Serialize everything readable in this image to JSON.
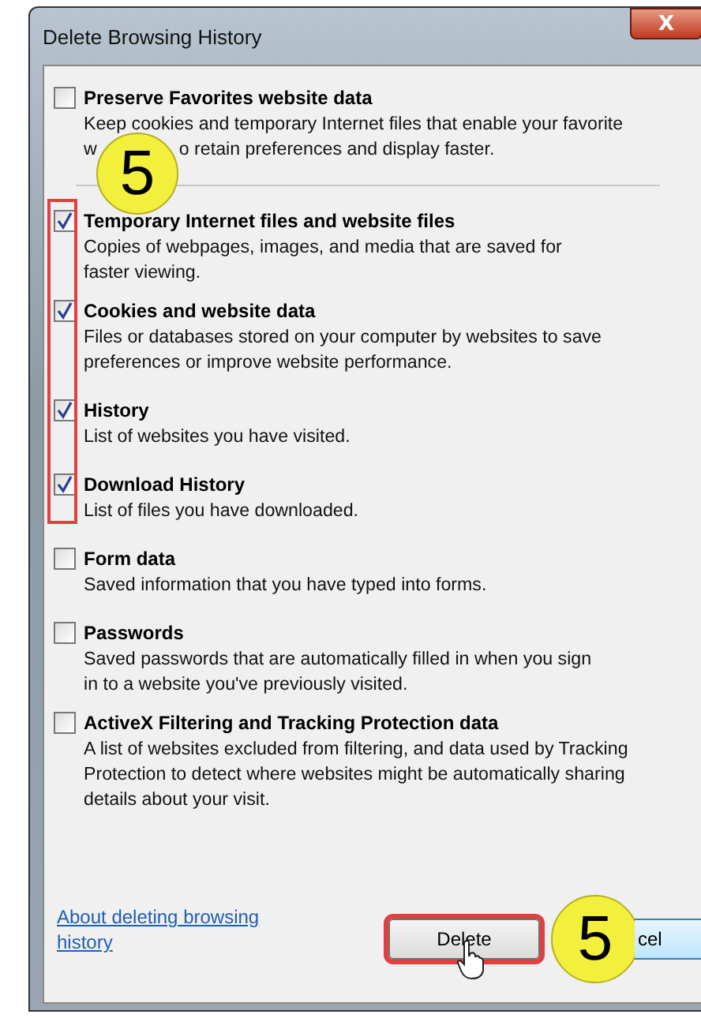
{
  "window": {
    "title": "Delete Browsing History",
    "close": "X"
  },
  "preserve": {
    "label": "Preserve Favorites website data",
    "description_line": "Keep cookies and temporary Internet files that enable your favorite",
    "description_fragments": [
      "w",
      "o retain preferences and display faster."
    ],
    "checked": false
  },
  "options": [
    {
      "label": "Temporary Internet files and website files",
      "description": "Copies of webpages, images, and media that are saved for\nfaster viewing.",
      "checked": true
    },
    {
      "label": "Cookies and website data",
      "description": "Files or databases stored on your computer by websites to save\npreferences or improve website performance.",
      "checked": true
    },
    {
      "label": "History",
      "description": "List of websites you have visited.",
      "checked": true
    },
    {
      "label": "Download History",
      "description": "List of files you have downloaded.",
      "checked": true
    },
    {
      "label": "Form data",
      "description": "Saved information that you have typed into forms.",
      "checked": false
    },
    {
      "label": "Passwords",
      "description": "Saved passwords that are automatically filled in when you sign\nin to a website you've previously visited.",
      "checked": false
    },
    {
      "label": "ActiveX Filtering and Tracking Protection data",
      "description": "A list of websites excluded from filtering, and data used by Tracking\nProtection to detect where websites might be automatically sharing\ndetails about your visit.",
      "checked": false
    }
  ],
  "link": "About deleting browsing history",
  "buttons": [
    "Delete",
    "cel"
  ],
  "step_badges": [
    "5",
    "5"
  ]
}
